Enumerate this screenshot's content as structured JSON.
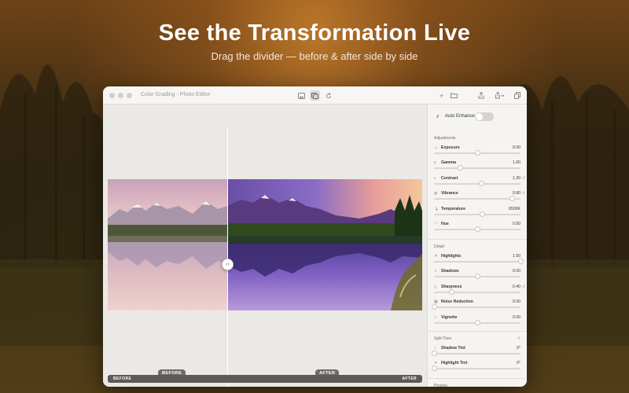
{
  "hero": {
    "headline": "See the Transformation Live",
    "subline": "Drag the divider — before & after side by side"
  },
  "window": {
    "title": "Color Grading - Photo Editor",
    "toolbar_center": [
      {
        "name": "image-icon",
        "active": false
      },
      {
        "name": "compare-icon",
        "active": true
      },
      {
        "name": "revert-icon",
        "active": false
      }
    ],
    "toolbar_right": [
      "plus-icon",
      "folder-icon",
      "export-icon",
      "share-icon",
      "copy-icon"
    ]
  },
  "canvas": {
    "divider_label_before": "BEFORE",
    "divider_label_after": "AFTER",
    "handle_glyph": "‹›",
    "bottom_before": "BEFORE",
    "bottom_after": "AFTER"
  },
  "panel": {
    "auto_enhance": {
      "label": "Auto Enhance",
      "on": false
    },
    "sections": [
      {
        "title": "Adjustments",
        "controls": [
          {
            "icon": "☼",
            "label": "Exposure",
            "value": "0.00",
            "level": 0.5,
            "reset": false
          },
          {
            "icon": "γ",
            "label": "Gamma",
            "value": "1.00",
            "level": 0.3,
            "reset": false
          },
          {
            "icon": "◐",
            "label": "Contrast",
            "value": "1.30",
            "level": 0.55,
            "reset": true
          },
          {
            "icon": "◍",
            "label": "Vibrance",
            "value": "0.80",
            "level": 0.9,
            "reset": true
          },
          {
            "icon": "🌡",
            "label": "Temperature",
            "value": "6500K",
            "level": 0.56,
            "reset": false
          },
          {
            "icon": "◠",
            "label": "Hue",
            "value": "0.00",
            "level": 0.5,
            "reset": false
          }
        ]
      },
      {
        "title": "Detail",
        "controls": [
          {
            "icon": "☀",
            "label": "Highlights",
            "value": "1.00",
            "level": 1.0,
            "reset": false
          },
          {
            "icon": "◑",
            "label": "Shadows",
            "value": "0.00",
            "level": 0.5,
            "reset": false
          },
          {
            "icon": "△",
            "label": "Sharpness",
            "value": "0.40",
            "level": 0.2,
            "reset": true
          },
          {
            "icon": "▦",
            "label": "Noise Reduction",
            "value": "0.00",
            "level": 0.0,
            "reset": false
          },
          {
            "icon": "○",
            "label": "Vignette",
            "value": "0.00",
            "level": 0.5,
            "reset": false
          }
        ]
      },
      {
        "title": "Split-Tone",
        "reset": true,
        "controls": [
          {
            "icon": "☾",
            "label": "Shadow Tint",
            "value": "0°",
            "level": 0.0,
            "reset": false
          },
          {
            "icon": "☀",
            "label": "Highlight Tint",
            "value": "0°",
            "level": 0.0,
            "reset": false
          }
        ]
      },
      {
        "title": "Presets",
        "controls": []
      }
    ]
  }
}
